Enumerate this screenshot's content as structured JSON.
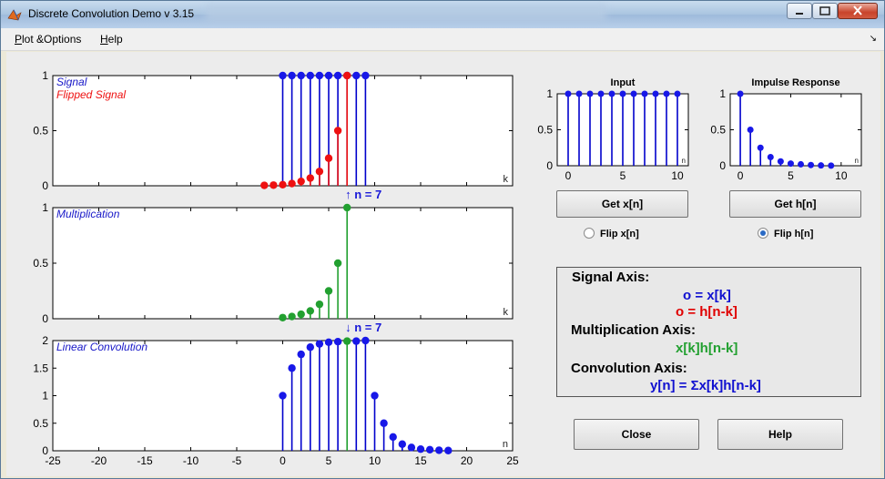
{
  "window": {
    "title": "Discrete Convolution Demo v 3.15"
  },
  "menu": {
    "items": [
      {
        "label": "Plot &Options",
        "accel": "P",
        "rest": "lot &Options"
      },
      {
        "label": "Help",
        "accel": "H",
        "rest": "elp"
      }
    ]
  },
  "colors": {
    "blue": "#0000ff",
    "red": "#ff0000",
    "green": "#22a030",
    "stem_blue": "#0000cc"
  },
  "chart_data": [
    {
      "name": "signal-axis",
      "type": "stem",
      "legend": [
        "Signal",
        "Flipped Signal"
      ],
      "xlim": [
        -25,
        25
      ],
      "ylim": [
        0,
        1
      ],
      "yticks": [
        "0",
        "0.5",
        "1"
      ],
      "xlabel": "k",
      "series": [
        {
          "name": "Signal",
          "color": "blue",
          "x": [
            0,
            1,
            2,
            3,
            4,
            5,
            6,
            7,
            8,
            9
          ],
          "y": [
            1,
            1,
            1,
            1,
            1,
            1,
            1,
            1,
            1,
            1
          ]
        },
        {
          "name": "Flipped Signal",
          "color": "red",
          "x": [
            -2,
            -1,
            0,
            1,
            2,
            3,
            4,
            5,
            6,
            7
          ],
          "y": [
            0.004,
            0.006,
            0.01,
            0.02,
            0.04,
            0.07,
            0.13,
            0.25,
            0.5,
            1
          ]
        }
      ],
      "marker": "↑ n = 7"
    },
    {
      "name": "multiplication-axis",
      "type": "stem",
      "legend": [
        "Multiplication"
      ],
      "xlim": [
        -25,
        25
      ],
      "ylim": [
        0,
        1
      ],
      "yticks": [
        "0",
        "0.5",
        "1"
      ],
      "xlabel": "k",
      "series": [
        {
          "name": "Multiplication",
          "color": "green",
          "x": [
            0,
            1,
            2,
            3,
            4,
            5,
            6,
            7
          ],
          "y": [
            0.01,
            0.02,
            0.04,
            0.07,
            0.13,
            0.25,
            0.5,
            1
          ]
        }
      ],
      "marker": "↓ n = 7"
    },
    {
      "name": "convolution-axis",
      "type": "stem",
      "legend": [
        "Linear Convolution"
      ],
      "xlim": [
        -25,
        25
      ],
      "ylim": [
        0,
        2
      ],
      "yticks": [
        "0",
        "0.5",
        "1",
        "1.5",
        "2"
      ],
      "xticks": [
        "-25",
        "-20",
        "-15",
        "-10",
        "-5",
        "0",
        "5",
        "10",
        "15",
        "20",
        "25"
      ],
      "xlabel": "n",
      "series": [
        {
          "name": "Linear Convolution",
          "color": "blue",
          "x": [
            0,
            1,
            2,
            3,
            4,
            5,
            6,
            7,
            8,
            9,
            10,
            11,
            12,
            13,
            14,
            15,
            16,
            17,
            18
          ],
          "y": [
            1,
            1.5,
            1.75,
            1.88,
            1.94,
            1.97,
            1.98,
            1.99,
            1.99,
            2,
            1,
            0.5,
            0.25,
            0.12,
            0.06,
            0.03,
            0.02,
            0.01,
            0.004
          ]
        }
      ],
      "highlight": {
        "x": 7,
        "color": "green"
      }
    },
    {
      "name": "input-axis",
      "type": "stem",
      "title": "Input",
      "xlim": [
        -1,
        11
      ],
      "ylim": [
        0,
        1
      ],
      "yticks": [
        "0",
        "0.5",
        "1"
      ],
      "xticks": [
        "0",
        "5",
        "10"
      ],
      "xlabel": "n",
      "series": [
        {
          "name": "x[n]",
          "color": "blue",
          "x": [
            0,
            1,
            2,
            3,
            4,
            5,
            6,
            7,
            8,
            9,
            10
          ],
          "y": [
            1,
            1,
            1,
            1,
            1,
            1,
            1,
            1,
            1,
            1,
            1
          ]
        }
      ]
    },
    {
      "name": "impulse-axis",
      "type": "stem",
      "title": "Impulse Response",
      "xlim": [
        -1,
        12
      ],
      "ylim": [
        0,
        1
      ],
      "yticks": [
        "0",
        "0.5",
        "1"
      ],
      "xticks": [
        "0",
        "5",
        "10"
      ],
      "xlabel": "n",
      "series": [
        {
          "name": "h[n]",
          "color": "blue",
          "x": [
            0,
            1,
            2,
            3,
            4,
            5,
            6,
            7,
            8,
            9
          ],
          "y": [
            1,
            0.5,
            0.25,
            0.12,
            0.06,
            0.03,
            0.02,
            0.01,
            0.004,
            0.002
          ]
        }
      ]
    }
  ],
  "controls": {
    "get_x": "Get x[n]",
    "get_h": "Get h[n]",
    "flip_x": "Flip x[n]",
    "flip_h": "Flip h[n]",
    "flip_selected": "h",
    "close": "Close",
    "help": "Help"
  },
  "legend_box": {
    "signal_axis": "Signal Axis:",
    "signal_line": "o = x[k]",
    "flipped_line": "o = h[n-k]",
    "mult_axis": "Multiplication Axis:",
    "mult_line": "x[k]h[n-k]",
    "conv_axis": "Convolution Axis:",
    "conv_line": "y[n] = Σx[k]h[n-k]"
  }
}
